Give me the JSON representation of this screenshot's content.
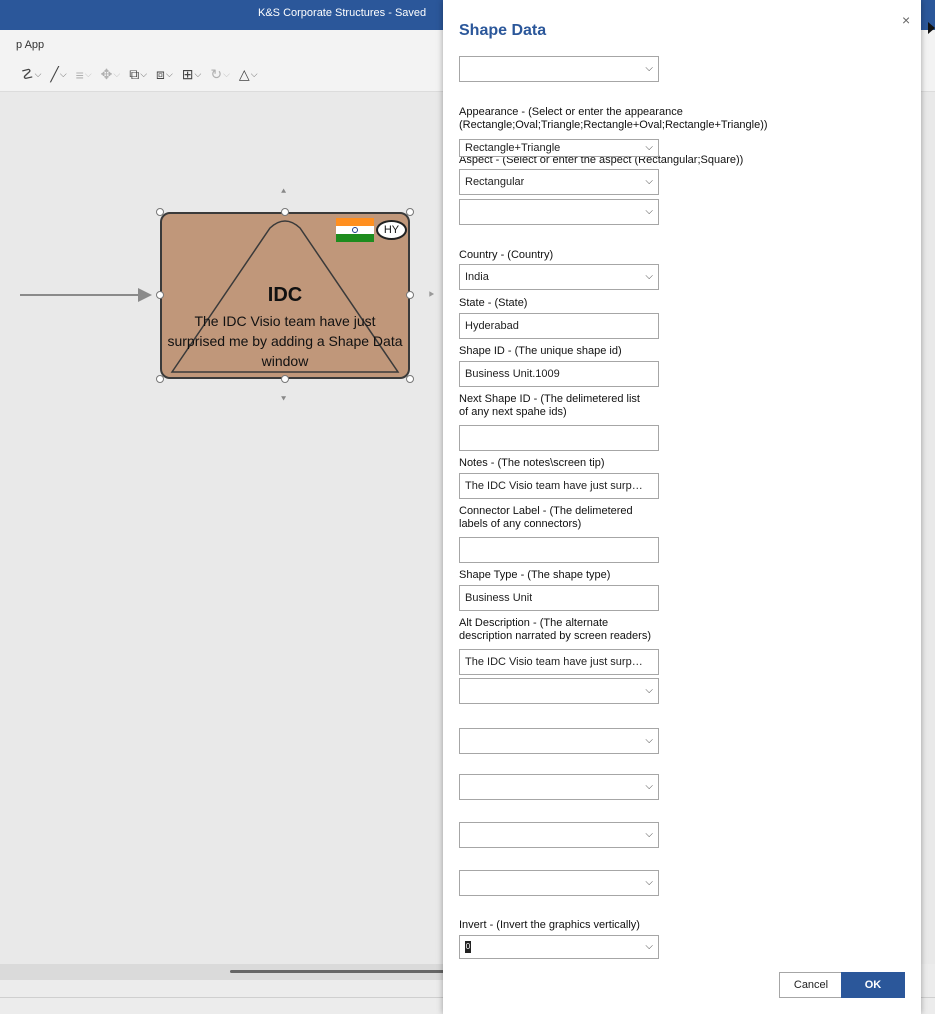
{
  "window": {
    "title": "K&S Corporate Structures - Saved",
    "app_name": "p App"
  },
  "toolbar": {
    "items": [
      "fill-color",
      "line-color",
      "align",
      "position",
      "bring-to-front",
      "send-to-back",
      "group",
      "rotate",
      "arrange"
    ]
  },
  "shape": {
    "title": "IDC",
    "text": "The IDC Visio team have just surprised me by adding a Shape Data window",
    "badge": "HY",
    "fill_color": "#c0977a"
  },
  "dialog": {
    "title": "Shape Data",
    "close_label": "×",
    "fields": {
      "blank_1": "",
      "appearance_label_1": "Appearance - (Select or enter the appearance",
      "appearance_label_2": "(Rectangle;Oval;Triangle;Rectangle+Oval;Rectangle+Triangle))",
      "appearance_value": "Rectangle+Triangle",
      "aspect_label": "Aspect - (Select or enter the aspect (Rectangular;Square))",
      "aspect_value": "Rectangular",
      "blank_2": "",
      "country_label": "Country - (Country)",
      "country_value": "India",
      "state_label": "State - (State)",
      "state_value": "Hyderabad",
      "shape_id_label": "Shape ID - (The unique shape id)",
      "shape_id_value": "Business Unit.1009",
      "next_shape_label_1": "Next Shape ID - (The delimetered list",
      "next_shape_label_2": "of any next spahe ids)",
      "next_shape_value": "",
      "notes_label": "Notes - (The notes\\screen tip)",
      "notes_value": "The IDC Visio team have just surprise...",
      "connector_label_1": "Connector Label - (The delimetered",
      "connector_label_2": "labels of any connectors)",
      "connector_value": "",
      "shape_type_label": "Shape Type - (The shape type)",
      "shape_type_value": "Business Unit",
      "alt_desc_label_1": "Alt Description - (The alternate",
      "alt_desc_label_2": "description narrated by screen readers)",
      "alt_desc_value": "The IDC Visio team have just surprise...",
      "blank_3": "",
      "blank_4": "",
      "blank_5": "",
      "blank_6": "",
      "blank_7": "",
      "invert_label": "Invert - (Invert the graphics vertically)",
      "invert_value": "0"
    },
    "cancel_label": "Cancel",
    "ok_label": "OK",
    "accent_color": "#2b579a"
  }
}
